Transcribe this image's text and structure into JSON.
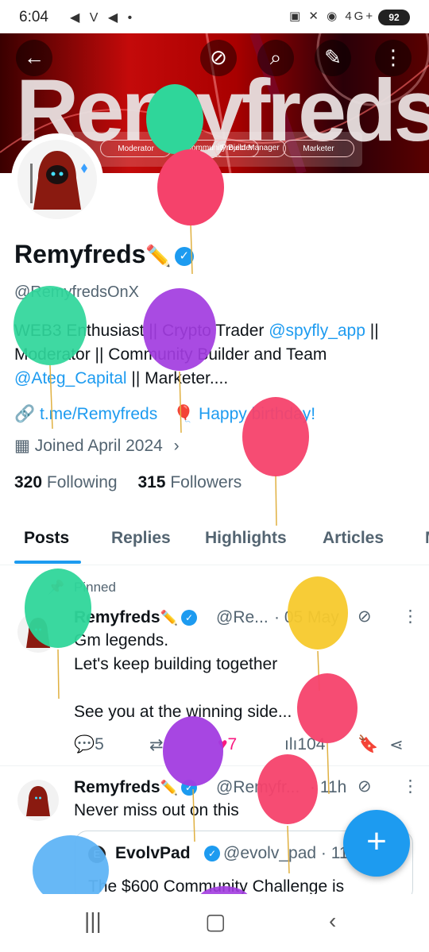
{
  "status_bar": {
    "time": "6:04",
    "left_icons": "◀ V ◀ •",
    "right_icons": "▣ ✕ ◉ 4G+ .ıl",
    "battery": "92"
  },
  "banner": {
    "word": "Remyfreds",
    "tags": [
      "Moderator",
      "Community Builder",
      "Project Manager",
      "Marketer"
    ]
  },
  "nav": {
    "back": "←",
    "grok": "⊘",
    "search": "⌕",
    "edit": "✎",
    "more": "⋮"
  },
  "profile": {
    "name": "Remyfreds",
    "name_emoji": "✏️",
    "verified_mark": "✓",
    "handle": "@RemyfredsOnX",
    "bio_part1": "WEB3 Enthusiast || Crypto Trader ",
    "bio_link1": "@spyfly_app",
    "bio_part2": " || Moderator || Community Builder and Team ",
    "bio_link2": "@Ateg_Capital",
    "bio_part3": " || Marketer....",
    "website": "t.me/Remyfreds",
    "birthday": "Happy birthday!",
    "joined": "Joined April 2024",
    "following_count": "320",
    "following_label": "Following",
    "followers_count": "315",
    "followers_label": "Followers"
  },
  "tabs": [
    "Posts",
    "Replies",
    "Highlights",
    "Articles",
    "M"
  ],
  "posts": [
    {
      "pinned_label": "Pinned",
      "name": "Remyfreds",
      "handle": "@Re...",
      "time": "· 05 May",
      "lines": [
        "Gm legends.",
        "Let's keep building together",
        "",
        "See you at the winning side..."
      ],
      "replies": "5",
      "likes": "7",
      "views": "104"
    },
    {
      "name": "Remyfreds",
      "handle": "@Remyfr...",
      "time": "· 11h",
      "text": "Never miss out on this",
      "quote_name": "EvolvPad",
      "quote_handle": "@evolv_pad · 11",
      "quote_text": "The $600 Community Challenge is"
    }
  ],
  "colors": {
    "accent": "#1d9bf0",
    "like": "#f91880",
    "balloon_green": "#2fd69a",
    "balloon_pink": "#f5426b",
    "balloon_purple": "#a23ce0",
    "balloon_yellow": "#f7c92c",
    "balloon_blue": "#5fb4f5"
  }
}
